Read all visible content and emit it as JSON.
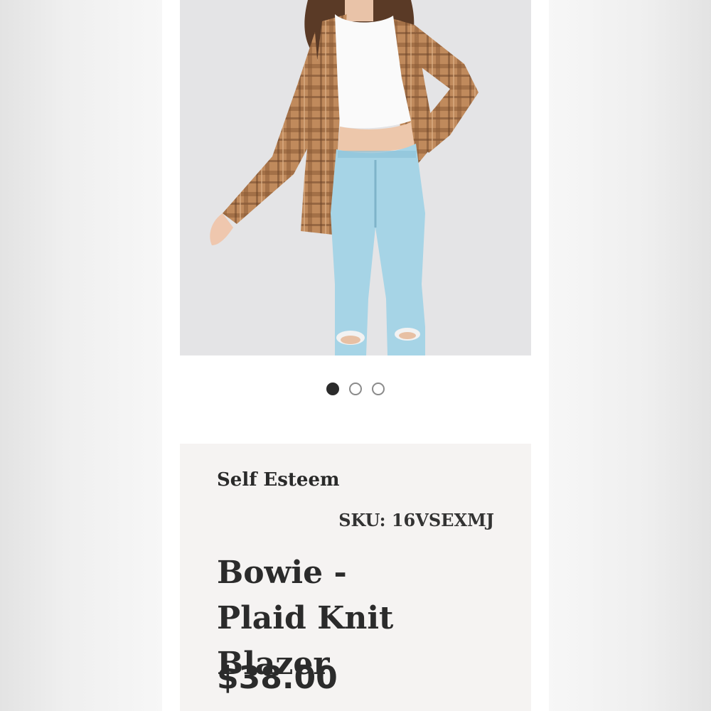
{
  "product": {
    "brand": "Self Esteem",
    "sku": "SKU: 16VSEXMJ",
    "title": "Bowie - Plaid Knit Blazer",
    "price": "$38.00"
  },
  "gallery": {
    "image_count": 3,
    "active_index": 0
  },
  "colors": {
    "photo_background": "#e4e4e6",
    "panel_background": "#f5f3f2",
    "blazer": "#b07a4f",
    "jeans": "#a6d4e6",
    "top": "#fafafa",
    "dot_active": "#2b2b2b"
  }
}
